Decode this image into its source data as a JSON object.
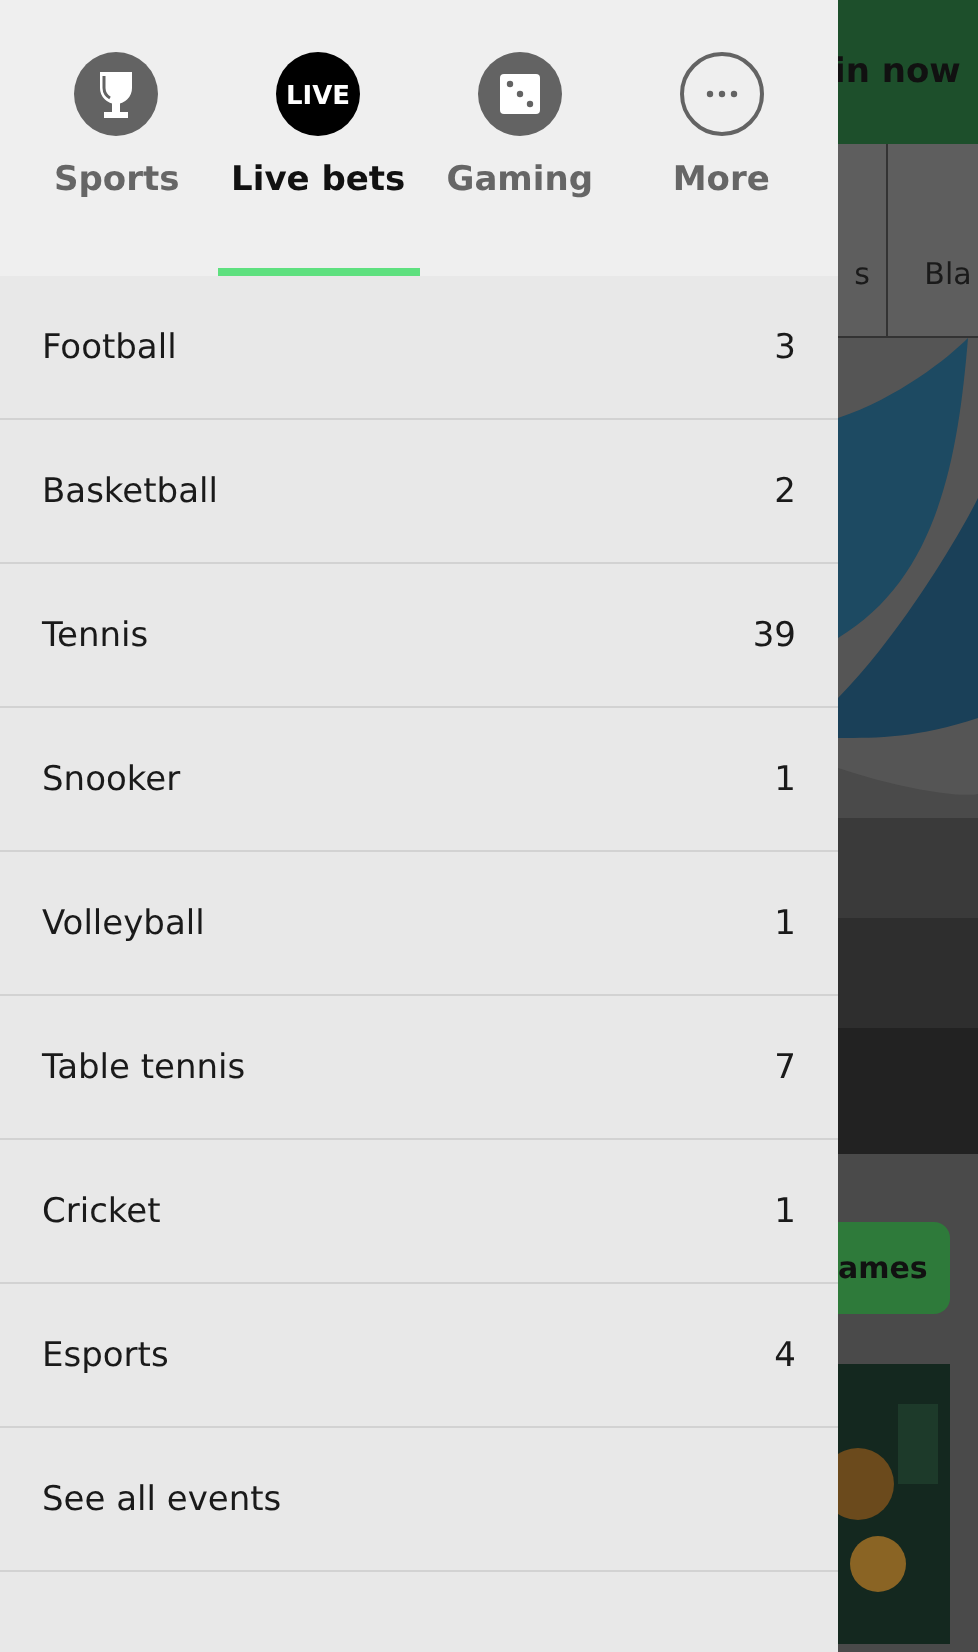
{
  "drawer": {
    "tabs": [
      {
        "kind": "trophy",
        "label": "Sports",
        "selected": false
      },
      {
        "kind": "live",
        "icon_text": "LIVE",
        "label": "Live bets",
        "selected": true
      },
      {
        "kind": "dice",
        "label": "Gaming",
        "selected": false
      },
      {
        "kind": "more",
        "label": "More",
        "selected": false
      }
    ],
    "items": [
      {
        "label": "Football",
        "count": "3"
      },
      {
        "label": "Basketball",
        "count": "2"
      },
      {
        "label": "Tennis",
        "count": "39"
      },
      {
        "label": "Snooker",
        "count": "1"
      },
      {
        "label": "Volleyball",
        "count": "1"
      },
      {
        "label": "Table tennis",
        "count": "7"
      },
      {
        "label": "Cricket",
        "count": "1"
      },
      {
        "label": "Esports",
        "count": "4"
      },
      {
        "label": "See all events"
      }
    ]
  },
  "background_page": {
    "join_button": "in now",
    "nav_items": [
      "s",
      "Bla"
    ],
    "games_button": "ames"
  }
}
